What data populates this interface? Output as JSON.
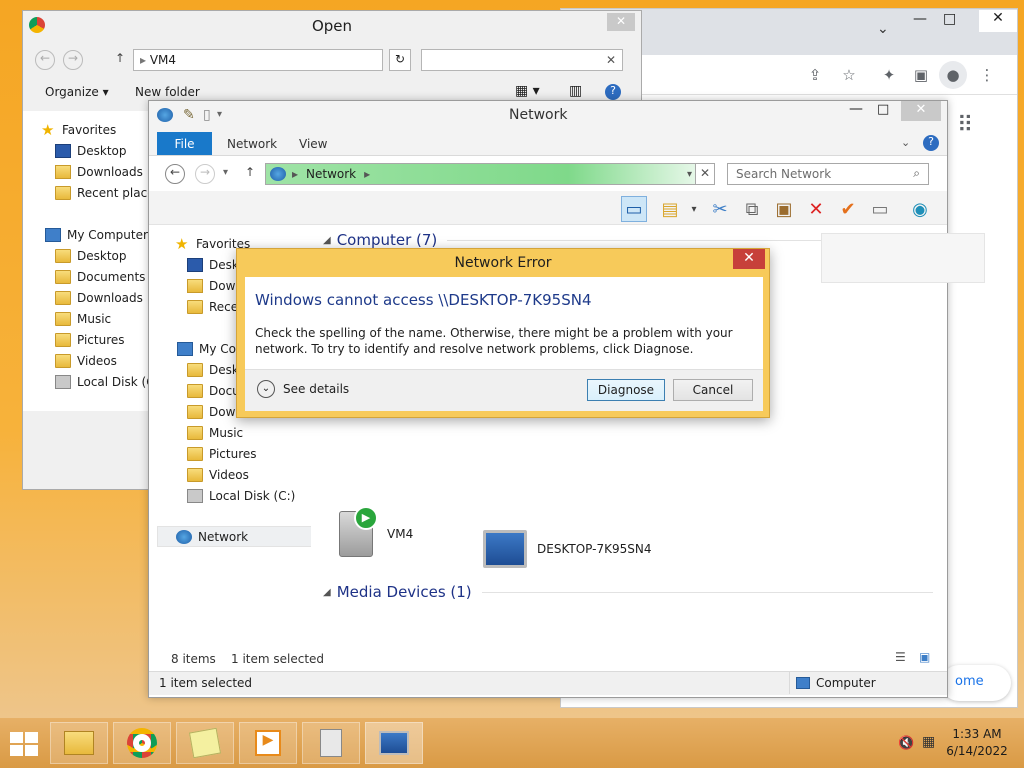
{
  "chrome": {
    "minimize": "—",
    "maximize": "□",
    "close": "✕",
    "welcome_text": "ome",
    "tab_dropdown": "⌄"
  },
  "open_dialog": {
    "title": "Open",
    "close": "✕",
    "path": "VM4",
    "organize": "Organize",
    "new_folder": "New folder",
    "favorites": "Favorites",
    "fav_items": [
      "Desktop",
      "Downloads",
      "Recent places"
    ],
    "my_computer": "My Computer",
    "pc_items": [
      "Desktop",
      "Documents",
      "Downloads",
      "Music",
      "Pictures",
      "Videos",
      "Local Disk (C:"
    ]
  },
  "explorer": {
    "title": "Network",
    "tabs": {
      "file": "File",
      "network": "Network",
      "view": "View"
    },
    "address": "Network",
    "search_placeholder": "Search Network",
    "nav": {
      "favorites": "Favorites",
      "fav_items": [
        "Deskt",
        "Down",
        "Recen"
      ],
      "my_computer": "My Com",
      "pc_items": [
        "Deskt",
        "Docu",
        "Down",
        "Music",
        "Pictures",
        "Videos",
        "Local Disk (C:)"
      ],
      "network": "Network"
    },
    "groups": {
      "computer": "Computer (7)",
      "media": "Media Devices (1)"
    },
    "items": {
      "desktop_pc": "DESKTOP-7K95SN4",
      "vm4": "VM4"
    },
    "status": {
      "count": "8 items",
      "selected": "1 item selected"
    },
    "details": {
      "selected": "1 item selected",
      "location": "Computer"
    }
  },
  "error_dialog": {
    "title": "Network Error",
    "close": "✕",
    "heading": "Windows cannot access \\\\DESKTOP-7K95SN4",
    "message": "Check the spelling of the name. Otherwise, there might be a problem with your network. To try to identify and resolve network problems, click Diagnose.",
    "see_details": "See details",
    "diagnose": "Diagnose",
    "cancel": "Cancel"
  },
  "taskbar": {
    "time": "1:33 AM",
    "date": "6/14/2022"
  }
}
